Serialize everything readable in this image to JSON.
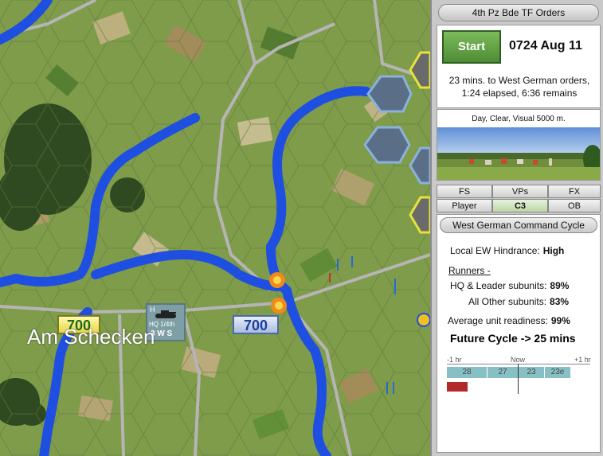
{
  "panel": {
    "title": "4th Pz Bde TF Orders",
    "start_label": "Start",
    "clock": "0724 Aug 11",
    "orders_line1": "23 mins. to West German orders,",
    "orders_line2": "1:24 elapsed, 6:36 remains",
    "weather": "Day, Clear, Visual 5000 m."
  },
  "tabs": {
    "fs": "FS",
    "vps": "VPs",
    "fx": "FX",
    "player": "Player",
    "c3": "C3",
    "ob": "OB"
  },
  "c3": {
    "title": "West German Command Cycle",
    "ew_label": "Local EW Hindrance:",
    "ew_value": "High",
    "runners_label": "Runners -",
    "hq_label": "HQ & Leader subunits:",
    "hq_value": "89%",
    "other_label": "All Other subunits:",
    "other_value": "83%",
    "readiness_label": "Average unit readiness:",
    "readiness_value": "99%",
    "future": "Future Cycle -> 25 mins",
    "timeline": {
      "left": "-1 hr",
      "mid": "Now",
      "right": "+1 hr",
      "segments": [
        "28",
        "27",
        "23",
        "23e"
      ]
    }
  },
  "map": {
    "town_label": "Am Schecken",
    "unit_label": "HQ 1/4th",
    "unit_stats": "3 W S",
    "unit_h": "H",
    "marker_left": "700",
    "marker_right": "700",
    "colors": {
      "river": "#1f4fe0",
      "road": "#9a9a9a",
      "forest": "#2f4a20",
      "field": "#7d9a4a"
    }
  }
}
